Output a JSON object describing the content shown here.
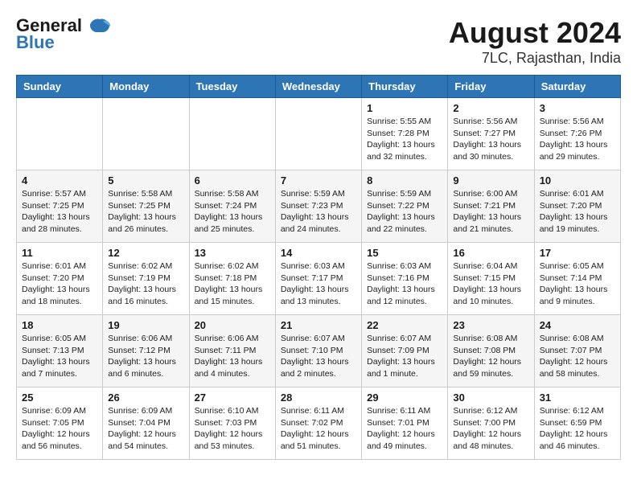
{
  "header": {
    "logo_line1": "General",
    "logo_line2": "Blue",
    "month_title": "August 2024",
    "location": "7LC, Rajasthan, India"
  },
  "weekdays": [
    "Sunday",
    "Monday",
    "Tuesday",
    "Wednesday",
    "Thursday",
    "Friday",
    "Saturday"
  ],
  "weeks": [
    [
      {
        "day": "",
        "info": ""
      },
      {
        "day": "",
        "info": ""
      },
      {
        "day": "",
        "info": ""
      },
      {
        "day": "",
        "info": ""
      },
      {
        "day": "1",
        "info": "Sunrise: 5:55 AM\nSunset: 7:28 PM\nDaylight: 13 hours\nand 32 minutes."
      },
      {
        "day": "2",
        "info": "Sunrise: 5:56 AM\nSunset: 7:27 PM\nDaylight: 13 hours\nand 30 minutes."
      },
      {
        "day": "3",
        "info": "Sunrise: 5:56 AM\nSunset: 7:26 PM\nDaylight: 13 hours\nand 29 minutes."
      }
    ],
    [
      {
        "day": "4",
        "info": "Sunrise: 5:57 AM\nSunset: 7:25 PM\nDaylight: 13 hours\nand 28 minutes."
      },
      {
        "day": "5",
        "info": "Sunrise: 5:58 AM\nSunset: 7:25 PM\nDaylight: 13 hours\nand 26 minutes."
      },
      {
        "day": "6",
        "info": "Sunrise: 5:58 AM\nSunset: 7:24 PM\nDaylight: 13 hours\nand 25 minutes."
      },
      {
        "day": "7",
        "info": "Sunrise: 5:59 AM\nSunset: 7:23 PM\nDaylight: 13 hours\nand 24 minutes."
      },
      {
        "day": "8",
        "info": "Sunrise: 5:59 AM\nSunset: 7:22 PM\nDaylight: 13 hours\nand 22 minutes."
      },
      {
        "day": "9",
        "info": "Sunrise: 6:00 AM\nSunset: 7:21 PM\nDaylight: 13 hours\nand 21 minutes."
      },
      {
        "day": "10",
        "info": "Sunrise: 6:01 AM\nSunset: 7:20 PM\nDaylight: 13 hours\nand 19 minutes."
      }
    ],
    [
      {
        "day": "11",
        "info": "Sunrise: 6:01 AM\nSunset: 7:20 PM\nDaylight: 13 hours\nand 18 minutes."
      },
      {
        "day": "12",
        "info": "Sunrise: 6:02 AM\nSunset: 7:19 PM\nDaylight: 13 hours\nand 16 minutes."
      },
      {
        "day": "13",
        "info": "Sunrise: 6:02 AM\nSunset: 7:18 PM\nDaylight: 13 hours\nand 15 minutes."
      },
      {
        "day": "14",
        "info": "Sunrise: 6:03 AM\nSunset: 7:17 PM\nDaylight: 13 hours\nand 13 minutes."
      },
      {
        "day": "15",
        "info": "Sunrise: 6:03 AM\nSunset: 7:16 PM\nDaylight: 13 hours\nand 12 minutes."
      },
      {
        "day": "16",
        "info": "Sunrise: 6:04 AM\nSunset: 7:15 PM\nDaylight: 13 hours\nand 10 minutes."
      },
      {
        "day": "17",
        "info": "Sunrise: 6:05 AM\nSunset: 7:14 PM\nDaylight: 13 hours\nand 9 minutes."
      }
    ],
    [
      {
        "day": "18",
        "info": "Sunrise: 6:05 AM\nSunset: 7:13 PM\nDaylight: 13 hours\nand 7 minutes."
      },
      {
        "day": "19",
        "info": "Sunrise: 6:06 AM\nSunset: 7:12 PM\nDaylight: 13 hours\nand 6 minutes."
      },
      {
        "day": "20",
        "info": "Sunrise: 6:06 AM\nSunset: 7:11 PM\nDaylight: 13 hours\nand 4 minutes."
      },
      {
        "day": "21",
        "info": "Sunrise: 6:07 AM\nSunset: 7:10 PM\nDaylight: 13 hours\nand 2 minutes."
      },
      {
        "day": "22",
        "info": "Sunrise: 6:07 AM\nSunset: 7:09 PM\nDaylight: 13 hours\nand 1 minute."
      },
      {
        "day": "23",
        "info": "Sunrise: 6:08 AM\nSunset: 7:08 PM\nDaylight: 12 hours\nand 59 minutes."
      },
      {
        "day": "24",
        "info": "Sunrise: 6:08 AM\nSunset: 7:07 PM\nDaylight: 12 hours\nand 58 minutes."
      }
    ],
    [
      {
        "day": "25",
        "info": "Sunrise: 6:09 AM\nSunset: 7:05 PM\nDaylight: 12 hours\nand 56 minutes."
      },
      {
        "day": "26",
        "info": "Sunrise: 6:09 AM\nSunset: 7:04 PM\nDaylight: 12 hours\nand 54 minutes."
      },
      {
        "day": "27",
        "info": "Sunrise: 6:10 AM\nSunset: 7:03 PM\nDaylight: 12 hours\nand 53 minutes."
      },
      {
        "day": "28",
        "info": "Sunrise: 6:11 AM\nSunset: 7:02 PM\nDaylight: 12 hours\nand 51 minutes."
      },
      {
        "day": "29",
        "info": "Sunrise: 6:11 AM\nSunset: 7:01 PM\nDaylight: 12 hours\nand 49 minutes."
      },
      {
        "day": "30",
        "info": "Sunrise: 6:12 AM\nSunset: 7:00 PM\nDaylight: 12 hours\nand 48 minutes."
      },
      {
        "day": "31",
        "info": "Sunrise: 6:12 AM\nSunset: 6:59 PM\nDaylight: 12 hours\nand 46 minutes."
      }
    ]
  ]
}
